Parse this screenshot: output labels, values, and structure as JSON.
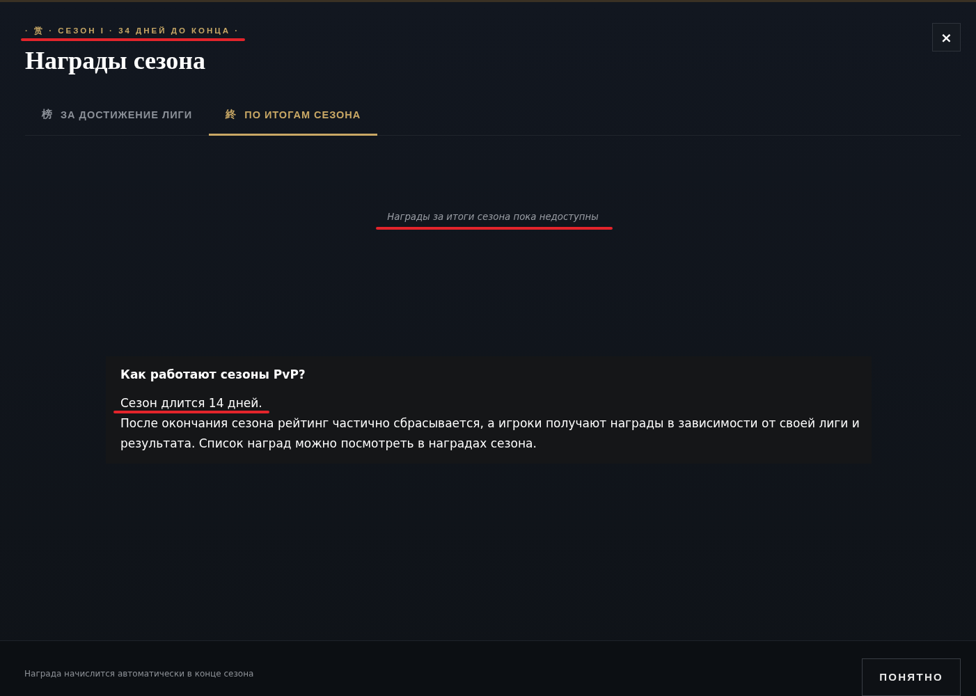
{
  "top_label": {
    "text": "· 赏 · СЕЗОН I · 34 ДНЕЙ ДО КОНЦА ·",
    "underlined": true
  },
  "title": "Награды сезона",
  "close_button": {
    "label": "×"
  },
  "tabs": [
    {
      "icon": "榜",
      "label": "ЗА ДОСТИЖЕНИЕ ЛИГИ",
      "selected": false
    },
    {
      "icon": "終",
      "label": "ПО ИТОГАМ СЕЗОНА",
      "selected": true
    }
  ],
  "empty_message": {
    "text": "Награды за итоги сезона пока недоступны",
    "underlined": true
  },
  "info": {
    "title": "Как работают сезоны PvP?",
    "paragraphs": [
      {
        "text": "Сезон длится 14 дней.",
        "underlined": true
      },
      {
        "text": "После окончания сезона рейтинг частично сбрасывается, а игроки получают награды в зависимости от своей лиги и результата. Список наград можно посмотреть в наградах сезона.",
        "underlined": false
      }
    ]
  },
  "footer": {
    "note": "Награда начислится автоматически в конце сезона",
    "button": "ПОНЯТНО"
  }
}
